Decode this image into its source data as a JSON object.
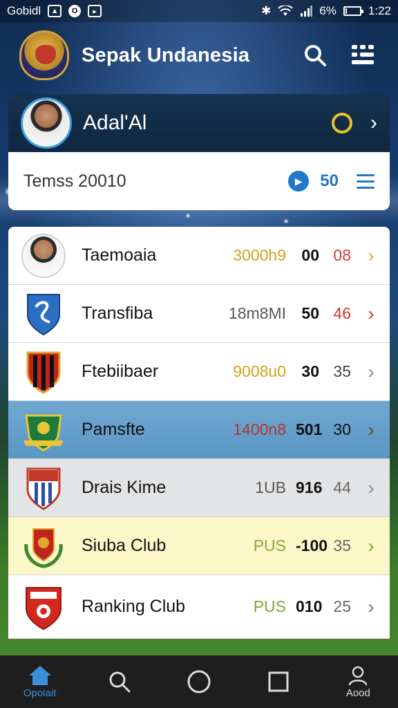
{
  "status_bar": {
    "carrier": "Gobidl",
    "battery": "6%",
    "time": "1:22"
  },
  "header": {
    "title": "Sepak Undanesia"
  },
  "profile": {
    "name": "Adal'Al"
  },
  "filter": {
    "label": "Temss 20010",
    "count": "50"
  },
  "teams": [
    {
      "name": "Taemoaia",
      "v1": "3000h9",
      "v2": "00",
      "v3": "08",
      "v1_color": "#d4a11a",
      "v3_color": "#d0392b",
      "chev_color": "#e5a823",
      "logo": "player-photo",
      "style": ""
    },
    {
      "name": "Transfiba",
      "v1": "18m8MI",
      "v2": "50",
      "v3": "46",
      "v1_color": "#555555",
      "v3_color": "#d0392b",
      "chev_color": "#d0392b",
      "logo": "blue-shield-crest",
      "style": ""
    },
    {
      "name": "Ftebiibaer",
      "v1": "9008u0",
      "v2": "30",
      "v3": "35",
      "v1_color": "#d4a11a",
      "v3_color": "#444444",
      "chev_color": "#888888",
      "logo": "red-black-crest",
      "style": ""
    },
    {
      "name": "Pamsfte",
      "v1": "1400n8",
      "v2": "501",
      "v3": "30",
      "v1_color": "#b7342a",
      "v3_color": "#111111",
      "chev_color": "#6b4a1a",
      "logo": "green-gold-crest",
      "style": "highlight-blue"
    },
    {
      "name": "Drais Kime",
      "v1": "1UB",
      "v2": "916",
      "v3": "44",
      "v1_color": "#555555",
      "v3_color": "#666666",
      "chev_color": "#888888",
      "logo": "red-white-crest",
      "style": "highlight-gray"
    },
    {
      "name": "Siuba Club",
      "v1": "PUS",
      "v2": "-100",
      "v3": "35",
      "v1_color": "#8aa83a",
      "v3_color": "#666666",
      "chev_color": "#7aa832",
      "logo": "laurel-crest",
      "style": "highlight-yellow"
    },
    {
      "name": "Ranking Club",
      "v1": "PUS",
      "v2": "010",
      "v3": "25",
      "v1_color": "#7aa832",
      "v3_color": "#666666",
      "chev_color": "#777777",
      "logo": "red-shield-crest",
      "style": "tall"
    }
  ],
  "bottom_nav": [
    {
      "name": "home",
      "label": "Opoiait",
      "active": true
    },
    {
      "name": "search",
      "label": "",
      "active": false
    },
    {
      "name": "circle",
      "label": "",
      "active": false
    },
    {
      "name": "square",
      "label": "",
      "active": false
    },
    {
      "name": "profile",
      "label": "Aood",
      "active": false
    }
  ],
  "colors": {
    "accent": "#1f78c8",
    "ring": "#e7c12f",
    "highlight_blue": "#6fa8d2",
    "highlight_yellow": "#fbf7c9"
  }
}
